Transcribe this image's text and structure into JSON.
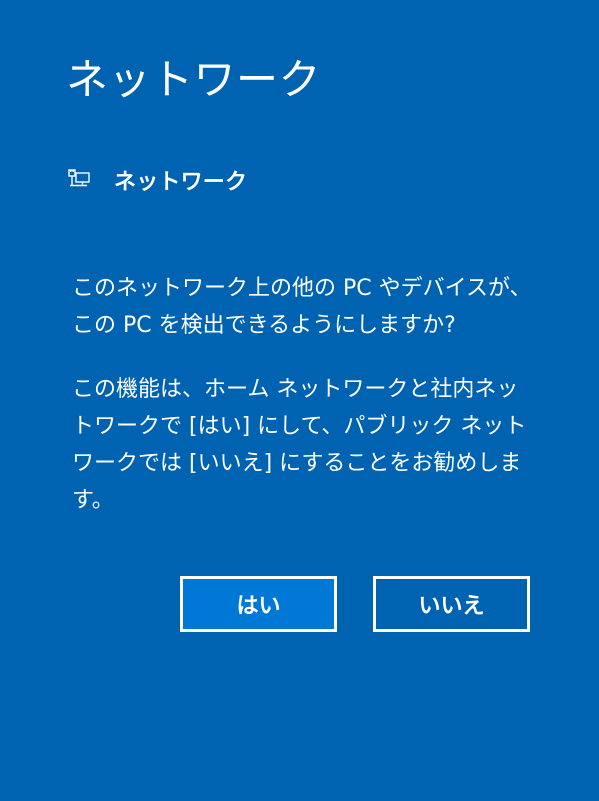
{
  "colors": {
    "background": "#0063b1",
    "primary_button": "#0078d7",
    "text": "#ffffff"
  },
  "panel": {
    "title": "ネットワーク"
  },
  "network": {
    "icon": "ethernet-network-icon",
    "name": "ネットワーク"
  },
  "prompt": {
    "question": "このネットワーク上の他の PC やデバイスが、この PC を検出できるようにしますか?",
    "description": "この機能は、ホーム ネットワークと社内ネットワークで [はい] にして、パブリック ネットワークでは [いいえ] にすることをお勧めします。"
  },
  "buttons": {
    "yes_label": "はい",
    "no_label": "いいえ"
  }
}
